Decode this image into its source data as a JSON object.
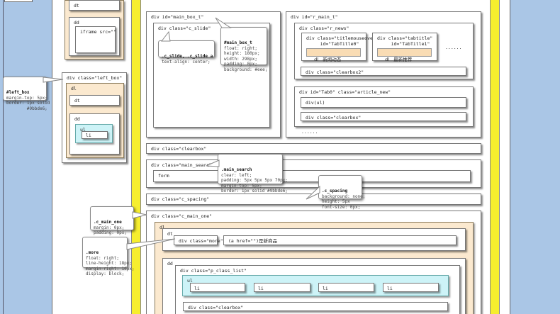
{
  "colors": {
    "page_bg": "#aac6e6",
    "yellow_frame": "#f6ee2e",
    "cream": "#fbe9cf",
    "cyan": "#cdf3f7",
    "white_box": "#ffffff"
  },
  "left_panel": {
    "dt_top": "dt",
    "dd_top": "dd",
    "iframe": "iframe src=\"\"",
    "left_box": "div class=\"left_box\"",
    "dl": "dl",
    "dt": "dt",
    "dd": "dd",
    "ul": "ul",
    "li": "li"
  },
  "notes": {
    "left_box": {
      "title": "#left_box",
      "body": "margin-top: 5px;\nborder: 1px solid\n        #9bbde6;"
    },
    "c_slide": {
      "title": ".c_slide, .c_slide a",
      "body": "text-align: center;"
    },
    "main_box_t": {
      "title": "#main_box_t",
      "body": "float: right;\nheight: 180px;\nwidth: 298px;\npadding: 0px;\nbackground: #eee;"
    },
    "main_search": {
      "title": ".main_search",
      "body": "clear: left;\npadding: 5px 5px 5px 70px;\nmargin-top: 5px;\nborder: 1px solid #9bbde6;"
    },
    "c_spacing": {
      "title": ".c_spacing",
      "body": "background: none;\nheight: 5px\nfont-size: 0px;"
    },
    "c_main_one": {
      "title": ".c_main_one",
      "body": "margin: 0px;\npadding: 0px;"
    },
    "more": {
      "title": ".more",
      "body": "float: right;\nline-height: 18px;\nmargin-right: 10px;\ndisplay: block;"
    }
  },
  "main": {
    "main_box_t": "div id=\"main_box_t\"",
    "c_slide": "div class=\"c_slide\"",
    "r_main_t": "div id=\"r_main_t\"",
    "r_news": "div class=\"r_news\"",
    "title1": "div class=\"titlemouseover\"\n     id=\"TabTitle0\"",
    "title2": "div class=\"tabtitle\"\n     id=\"TabTitle1\"",
    "tab1_dl": "dl",
    "tab1_text": "新闻动态",
    "tab2_dl": "dl",
    "tab2_text": "最新推荐",
    "ellipsis1": "......",
    "clearbox2": "div class=\"clearbox2\"",
    "tab0": "div id=\"Tab0\" class=\"article_new\"",
    "div_ul": "div(ul)",
    "clearbox_inner": "div class=\"clearbox\"",
    "ellipsis2": "......",
    "clearbox": "div class=\"clearbox\"",
    "main_search": "div class=\"main_search\"",
    "form": "form",
    "c_spacing": "div class=\"c_spacing\"",
    "c_main_one": "div class=\"c_main_one\"",
    "dl": "dl",
    "dt": "dt",
    "more": "div class=\"more\"",
    "ahref": "(a href=\"\")是新商品",
    "dd": "dd",
    "p_class_list": "div class=\"p_class_list\"",
    "ul": "ul",
    "li": [
      "li",
      "li",
      "li",
      "li"
    ],
    "clearbox_bottom": "div class=\"clearbox\""
  }
}
